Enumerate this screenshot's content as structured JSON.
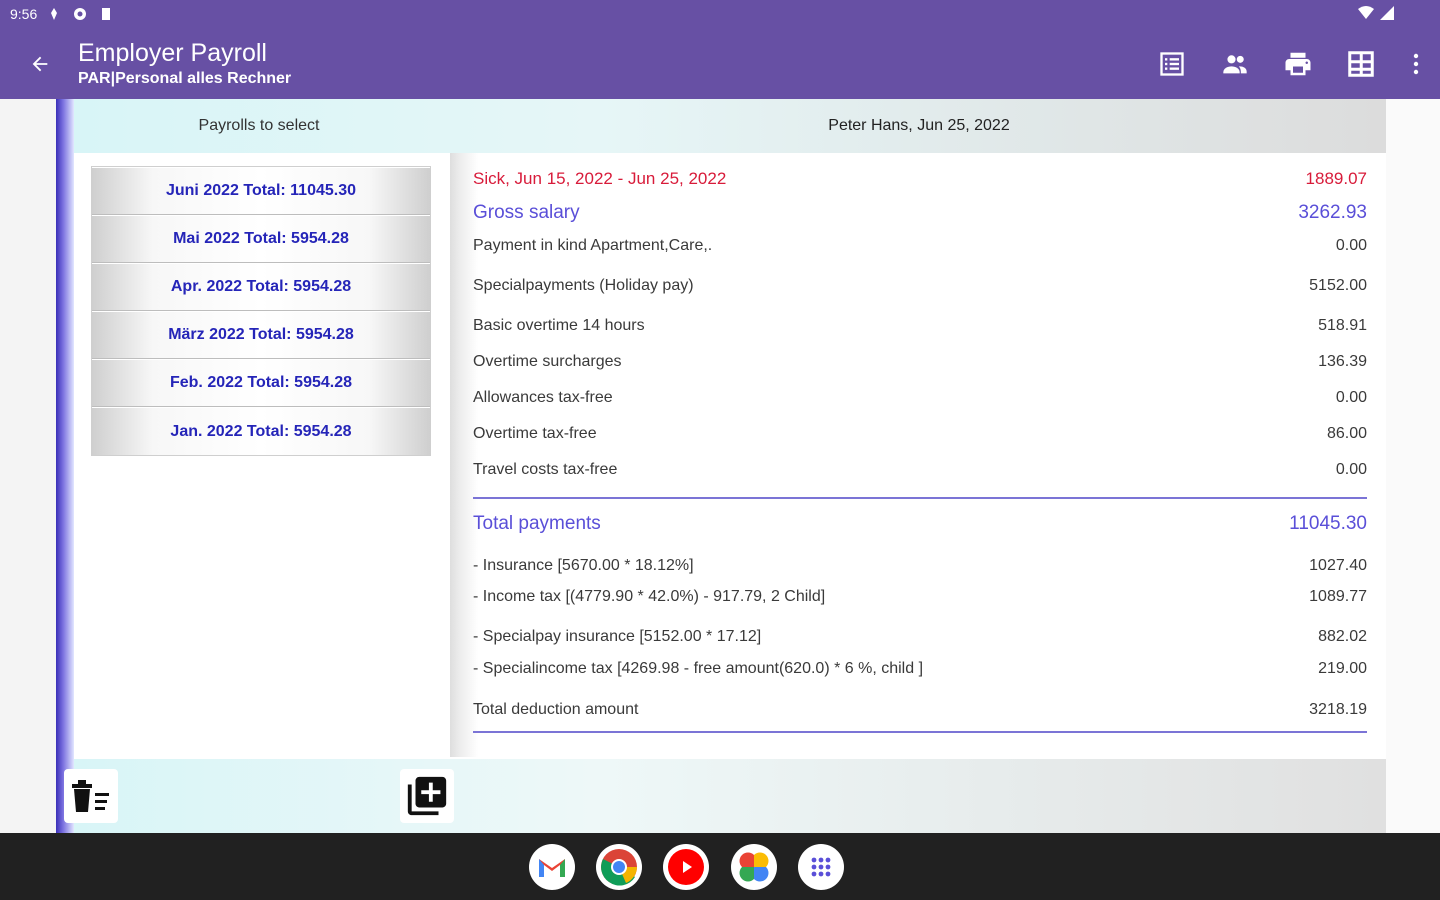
{
  "status_bar": {
    "time": "9:56"
  },
  "app_bar": {
    "title": "Employer Payroll",
    "subtitle": "PAR|Personal alles Rechner",
    "actions": [
      "list-icon",
      "people-icon",
      "print-icon",
      "grid-icon",
      "more-vert-icon"
    ]
  },
  "colors": {
    "app_bar": "#6750a4",
    "payroll_text": "#2525b8",
    "sick_text": "#d81b3a",
    "accent_text": "#5a4fd8",
    "rule": "#7b74d6"
  },
  "header": {
    "left_label": "Payrolls to select",
    "right_label": "Peter Hans, Jun 25, 2022"
  },
  "payrolls": [
    "Juni 2022 Total: 11045.30",
    "Mai 2022 Total: 5954.28",
    "Apr. 2022 Total: 5954.28",
    "März 2022 Total: 5954.28",
    "Feb. 2022 Total: 5954.28",
    "Jan. 2022 Total: 5954.28"
  ],
  "payslip": {
    "sick": {
      "label": "Sick, Jun 15, 2022 - Jun 25, 2022",
      "value": "1889.07"
    },
    "gross": {
      "label": "Gross salary",
      "value": "3262.93"
    },
    "payments": [
      {
        "label": "Payment in kind Apartment,Care,.",
        "value": "0.00"
      },
      {
        "label": "Specialpayments (Holiday pay)",
        "value": "5152.00"
      },
      {
        "label": "Basic overtime 14 hours",
        "value": "518.91"
      },
      {
        "label": "Overtime surcharges",
        "value": "136.39"
      },
      {
        "label": "Allowances tax-free",
        "value": "0.00"
      },
      {
        "label": "Overtime tax-free",
        "value": "86.00"
      },
      {
        "label": "Travel costs tax-free",
        "value": "0.00"
      }
    ],
    "total_payments": {
      "label": "Total payments",
      "value": "11045.30"
    },
    "deductions": [
      {
        "label": "- Insurance [5670.00 * 18.12%]",
        "value": "1027.40"
      },
      {
        "label": "- Income tax [(4779.90 * 42.0%) - 917.79, 2 Child]",
        "value": "1089.77"
      },
      {
        "label": "- Specialpay insurance [5152.00 * 17.12]",
        "value": "882.02"
      },
      {
        "label": "- Specialincome tax [4269.98 - free amount(620.0) * 6 %, child ]",
        "value": "219.00"
      }
    ],
    "total_deduction": {
      "label": "Total deduction amount",
      "value": "3218.19"
    }
  },
  "toolbar": {
    "buttons": [
      "delete-list-icon",
      "add-box-icon"
    ]
  },
  "dock": {
    "apps": [
      "gmail-icon",
      "chrome-icon",
      "youtube-icon",
      "photos-icon",
      "app-drawer-icon"
    ]
  }
}
